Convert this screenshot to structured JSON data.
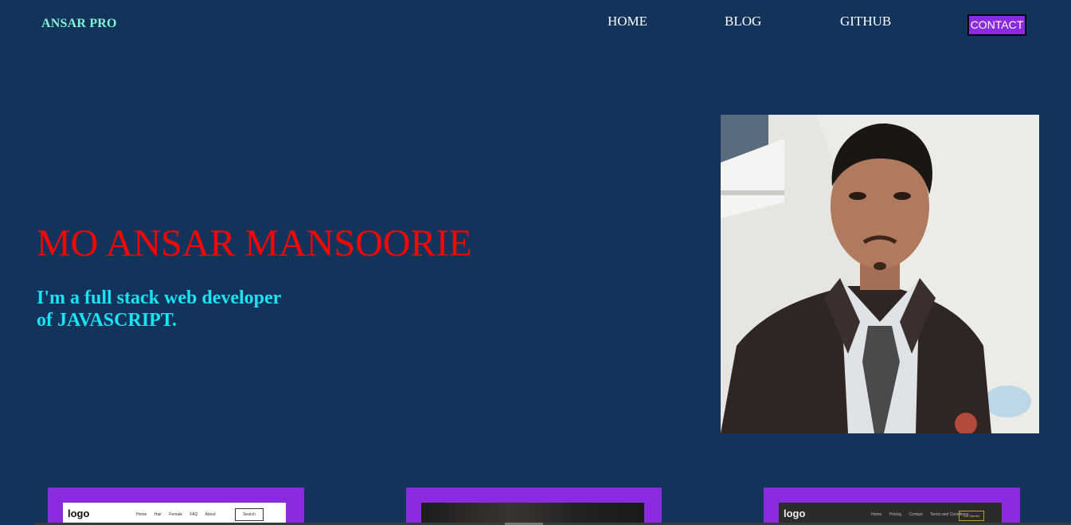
{
  "header": {
    "brand": "ANSAR PRO",
    "nav": [
      {
        "label": "HOME"
      },
      {
        "label": "BLOG"
      },
      {
        "label": "GITHUB"
      }
    ],
    "contact_label": "CONTACT"
  },
  "hero": {
    "title": "MO ANSAR MANSOORIE",
    "subtitle": "I'm a full stack web developer of JAVASCRIPT."
  },
  "portrait": {
    "icon": "person-portrait-photo"
  },
  "projects": [
    {
      "logo": "logo",
      "menu": [
        "Home",
        "Hair",
        "Female",
        "FAQ",
        "About"
      ],
      "search_label": "Search",
      "theme": "light"
    },
    {
      "theme": "dark-photo"
    },
    {
      "logo": "logo",
      "menu": [
        "Home",
        "Pricing",
        "Contact",
        "Terms and Conditions"
      ],
      "cta_label": "Get Started",
      "theme": "dark"
    }
  ],
  "colors": {
    "background": "#13345a",
    "brand": "#7ff5d2",
    "accent": "#8a2be2",
    "title": "#ff0000",
    "subtitle": "#19e3f4"
  }
}
